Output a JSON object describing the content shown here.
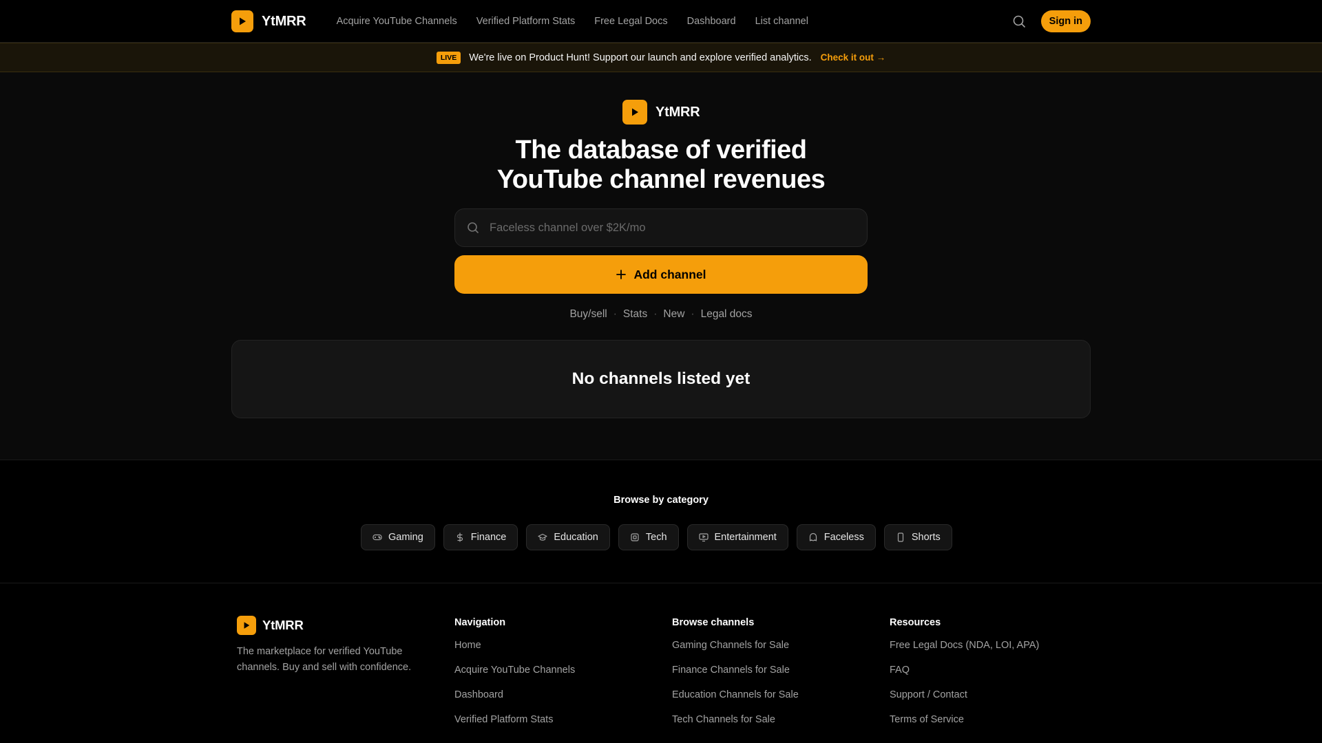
{
  "nav": {
    "brand": "YtMRR",
    "links": [
      "Acquire YouTube Channels",
      "Verified Platform Stats",
      "Free Legal Docs",
      "Dashboard",
      "List channel"
    ],
    "signin": "Sign in"
  },
  "banner": {
    "badge": "LIVE",
    "text": "We're live on Product Hunt! Support our launch and explore verified analytics.",
    "cta": "Check it out →"
  },
  "hero": {
    "brand": "YtMRR",
    "title_line1": "The database of verified",
    "title_line2": "YouTube channel revenues",
    "search_placeholder": "Faceless channel over $2K/mo",
    "add_button": "Add channel",
    "quicklinks": [
      "Buy/sell",
      "Stats",
      "New",
      "Legal docs"
    ],
    "empty_state": "No channels listed yet"
  },
  "categories": {
    "title": "Browse by category",
    "items": [
      {
        "label": "Gaming",
        "icon": "gamepad-icon"
      },
      {
        "label": "Finance",
        "icon": "dollar-icon"
      },
      {
        "label": "Education",
        "icon": "graduation-cap-icon"
      },
      {
        "label": "Tech",
        "icon": "cpu-icon"
      },
      {
        "label": "Entertainment",
        "icon": "tv-icon"
      },
      {
        "label": "Faceless",
        "icon": "ghost-icon"
      },
      {
        "label": "Shorts",
        "icon": "phone-icon"
      }
    ]
  },
  "footer": {
    "brand": "YtMRR",
    "description": "The marketplace for verified YouTube channels. Buy and sell with confidence.",
    "columns": [
      {
        "title": "Navigation",
        "links": [
          "Home",
          "Acquire YouTube Channels",
          "Dashboard",
          "Verified Platform Stats"
        ]
      },
      {
        "title": "Browse channels",
        "links": [
          "Gaming Channels for Sale",
          "Finance Channels for Sale",
          "Education Channels for Sale",
          "Tech Channels for Sale"
        ]
      },
      {
        "title": "Resources",
        "links": [
          "Free Legal Docs (NDA, LOI, APA)",
          "FAQ",
          "Support / Contact",
          "Terms of Service"
        ]
      }
    ]
  },
  "colors": {
    "accent": "#f59e0b",
    "background": "#0a0a0a"
  }
}
